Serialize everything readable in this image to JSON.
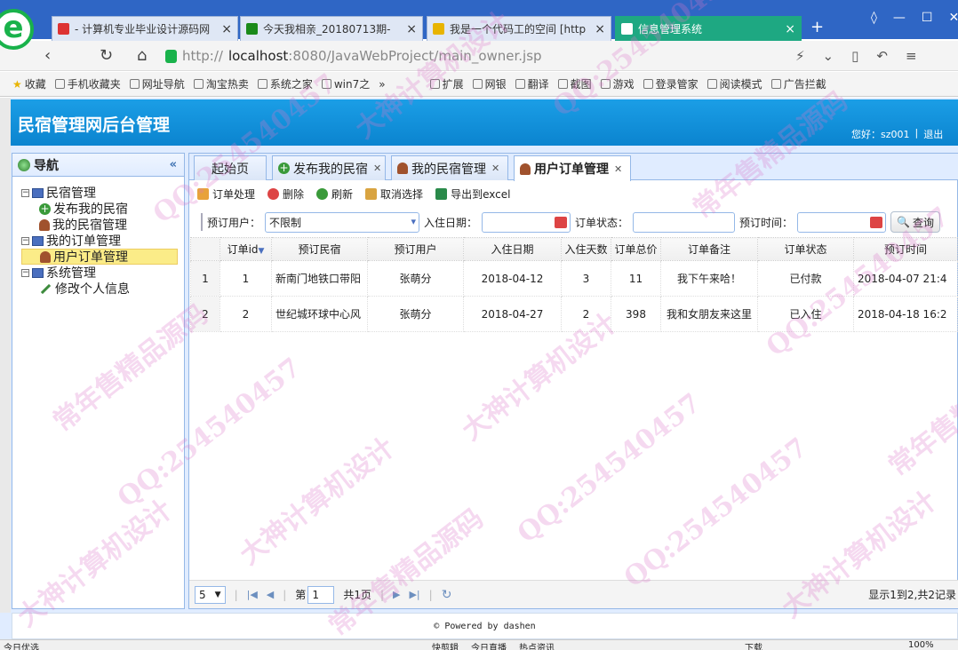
{
  "browser": {
    "logo": "e",
    "tabs": [
      {
        "label": "- 计算机专业毕业设计源码网",
        "fav_color": "#d33"
      },
      {
        "label": "今天我相亲_20180713期-",
        "fav_color": "#1a8a1a"
      },
      {
        "label": "我是一个代码工的空间 [http",
        "fav_color": "#e8b400"
      },
      {
        "label": "信息管理系统",
        "fav_color": "#ffffff"
      }
    ],
    "active_tab": 3,
    "address": {
      "scheme": "http://",
      "host": "localhost",
      "path": ":8080/JavaWebProject/main_owner.jsp"
    },
    "bookmarks": [
      "收藏",
      "手机收藏夹",
      "网址导航",
      "淘宝热卖",
      "系统之家",
      "win7之",
      "»",
      "扩展",
      "网银",
      "翻译",
      "截图",
      "游戏",
      "登录管家",
      "阅读模式",
      "广告拦截"
    ]
  },
  "app": {
    "title": "民宿管理网后台管理",
    "greeting": "您好：sz001",
    "logout": "退出",
    "nav_title": "导航",
    "tree": [
      {
        "label": "民宿管理",
        "children": [
          "发布我的民宿",
          "我的民宿管理"
        ]
      },
      {
        "label": "我的订单管理",
        "children": [
          "用户订单管理"
        ]
      },
      {
        "label": "系统管理",
        "children": [
          "修改个人信息"
        ]
      }
    ],
    "selected_node": "用户订单管理",
    "tabs": [
      "起始页",
      "发布我的民宿",
      "我的民宿管理",
      "用户订单管理"
    ],
    "active_tab": "用户订单管理",
    "toolbar": {
      "process": "订单处理",
      "delete": "删除",
      "refresh": "刷新",
      "unselect": "取消选择",
      "export": "导出到excel"
    },
    "filter": {
      "user_label": "预订用户：",
      "user_value": "不限制",
      "checkin_label": "入住日期：",
      "checkin_value": "",
      "status_label": "订单状态：",
      "status_value": "",
      "time_label": "预订时间：",
      "time_value": "",
      "search": "查询"
    },
    "columns": [
      "订单id",
      "预订民宿",
      "预订用户",
      "入住日期",
      "入住天数",
      "订单总价",
      "订单备注",
      "订单状态",
      "预订时间"
    ],
    "rows": [
      {
        "n": "1",
        "id": "1",
        "house": "新南门地铁口带阳",
        "user": "张萌分",
        "date": "2018-04-12",
        "days": "3",
        "total": "11",
        "note": "我下午来哈！",
        "status": "已付款",
        "time": "2018-04-07 21:4"
      },
      {
        "n": "2",
        "id": "2",
        "house": "世纪城环球中心风",
        "user": "张萌分",
        "date": "2018-04-27",
        "days": "2",
        "total": "398",
        "note": "我和女朋友来这里",
        "status": "已入住",
        "time": "2018-04-18 16:2"
      }
    ],
    "pager": {
      "page_size": "5",
      "page_prefix": "第",
      "page": "1",
      "total_pages": "共1页",
      "info": "显示1到2,共2记录"
    },
    "footer": "© Powered by dashen"
  },
  "statusbar": {
    "left": "今日优选",
    "right": [
      "快剪辑",
      "今日直播",
      "热点资讯",
      "下载",
      "100%"
    ]
  },
  "watermark": [
    "常年售精品源码",
    "QQ:254540457",
    "大神计算机设计"
  ]
}
